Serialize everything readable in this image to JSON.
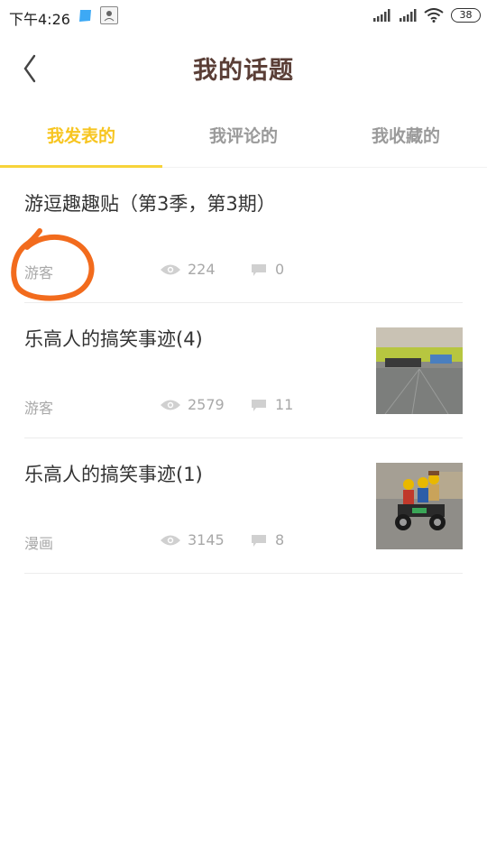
{
  "status_bar": {
    "time": "下午4:26",
    "battery": "38"
  },
  "header": {
    "title": "我的话题"
  },
  "tabs": [
    {
      "label": "我发表的",
      "active": true
    },
    {
      "label": "我评论的",
      "active": false
    },
    {
      "label": "我收藏的",
      "active": false
    }
  ],
  "posts": [
    {
      "title": "游逗趣趣贴（第3季，第3期）",
      "category": "游客",
      "views": "224",
      "comments": "0",
      "has_thumbnail": false
    },
    {
      "title": "乐高人的搞笑事迹(4)",
      "category": "游客",
      "views": "2579",
      "comments": "11",
      "has_thumbnail": true
    },
    {
      "title": "乐高人的搞笑事迹(1)",
      "category": "漫画",
      "views": "3145",
      "comments": "8",
      "has_thumbnail": true
    }
  ],
  "colors": {
    "accent": "#f7c520",
    "title": "#5a3e36",
    "annotation": "#f26b1d"
  }
}
